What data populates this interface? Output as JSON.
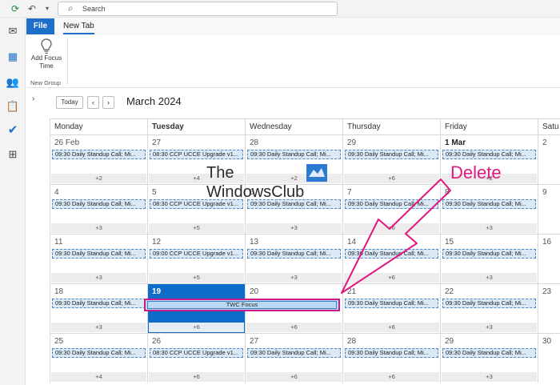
{
  "titlebar": {
    "search_placeholder": "Search"
  },
  "ribbon": {
    "file_tab": "File",
    "new_tab": "New Tab",
    "focus_button_label_line1": "Add Focus",
    "focus_button_label_line2": "Time",
    "group_label": "New Group"
  },
  "calendar": {
    "today_label": "Today",
    "month_title": "March 2024",
    "weekdays": [
      "Monday",
      "Tuesday",
      "Wednesday",
      "Thursday",
      "Friday",
      "Satu"
    ],
    "weeks": [
      [
        "26 Feb",
        "27",
        "28",
        "29",
        "1 Mar",
        "2"
      ],
      [
        "4",
        "5",
        "6",
        "7",
        "8",
        "9"
      ],
      [
        "11",
        "12",
        "13",
        "14",
        "15",
        "16"
      ],
      [
        "18",
        "19",
        "20",
        "21",
        "22",
        "23"
      ],
      [
        "25",
        "26",
        "27",
        "28",
        "29",
        "30"
      ]
    ],
    "events": {
      "standup": "09:30 Daily Standup Call; Mi...",
      "upgrade_0830": "08:30 CCP UCCE Upgrade v1...",
      "upgrade_0900": "09:00 CCP UCCE Upgrade v1...",
      "twc_focus": "TWC Focus"
    },
    "more_counts": [
      [
        "+2",
        "+4",
        "+2",
        "+6",
        "+2"
      ],
      [
        "+3",
        "+5",
        "+3",
        "+6",
        "+3"
      ],
      [
        "+3",
        "+5",
        "+3",
        "+6",
        "+3"
      ],
      [
        "+3",
        "+6",
        "+6",
        "+6",
        "+3"
      ],
      [
        "+4",
        "+6",
        "+6",
        "+6",
        "+3"
      ]
    ]
  },
  "annotation": {
    "delete_label": "Delete",
    "arrow_color": "#e0187f"
  },
  "watermark": {
    "line1": "The",
    "line2": "WindowsClub"
  },
  "colors": {
    "accent": "#1e6fc8",
    "today": "#0f6cc8",
    "highlight": "#cc1a8a"
  }
}
